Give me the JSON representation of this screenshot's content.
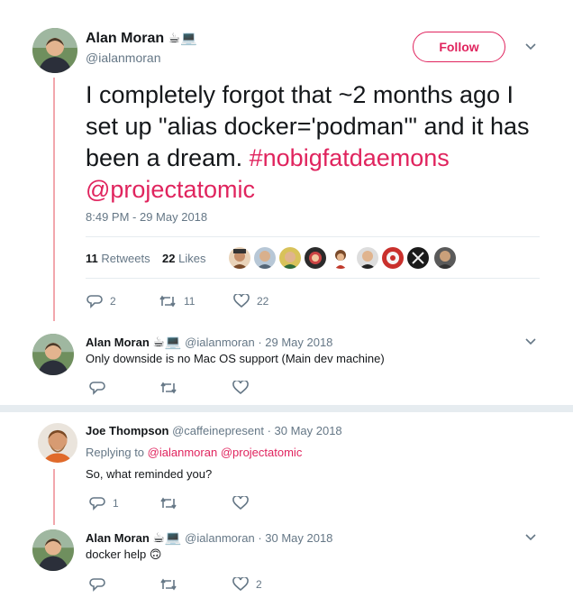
{
  "main_tweet": {
    "author_name": "Alan Moran",
    "author_badges": "☕💻",
    "handle": "@ialanmoran",
    "follow_label": "Follow",
    "text_plain": "I completely forgot that ~2 months ago I set up \"alias docker='podman'\" and it has been a dream. ",
    "hashtag": "#nobigfatdaemons",
    "mention": "@projectatomic",
    "timestamp": "8:49 PM - 29 May 2018",
    "retweets_count": "11",
    "retweets_label": "Retweets",
    "likes_count": "22",
    "likes_label": "Likes",
    "action_replies": "2",
    "action_retweets": "11",
    "action_likes": "22"
  },
  "replies": [
    {
      "author_name": "Alan Moran",
      "author_badges": "☕💻",
      "handle": "@ialanmoran",
      "date": "· 29 May 2018",
      "text": "Only downside is no Mac OS support (Main dev machine)"
    },
    {
      "author_name": "Joe Thompson",
      "handle": "@caffeinepresent",
      "date": "· 30 May 2018",
      "replying_to_label": "Replying to",
      "replying_to_1": "@ialanmoran",
      "replying_to_2": "@projectatomic",
      "text": "So, what reminded you?",
      "reply_count": "1"
    },
    {
      "author_name": "Alan Moran",
      "author_badges": "☕💻",
      "handle": "@ialanmoran",
      "date": "· 30 May 2018",
      "text": "docker help",
      "text_emoji": "🙃",
      "like_count": "2"
    }
  ],
  "colors": {
    "accent": "#e0245e",
    "muted": "#657786",
    "thread_line": "#f2a7ad",
    "divider": "#e6ecf0"
  },
  "icons": [
    "reply-icon",
    "retweet-icon",
    "like-icon",
    "chevron-down-icon"
  ]
}
